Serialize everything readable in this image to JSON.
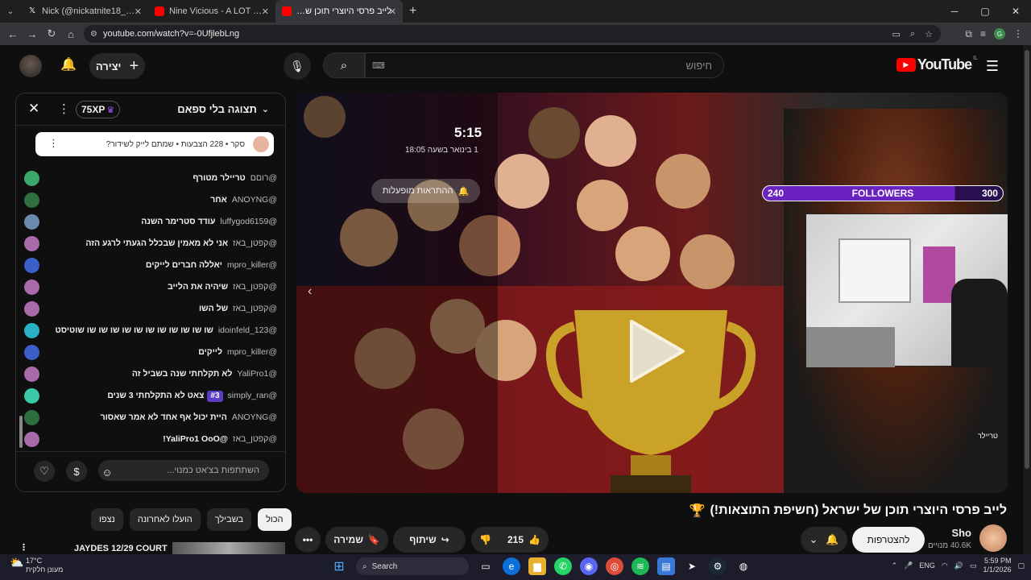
{
  "browser": {
    "tabs": [
      {
        "title": "Nick (@nickatnite18_) / X",
        "active": false
      },
      {
        "title": "Nine Vicious - A LOT (Official M",
        "active": false
      },
      {
        "title": "לייב פרסי היוצרי תוכן של ישראל",
        "active": true
      }
    ],
    "url": "youtube.com/watch?v=-0UfjlebLng",
    "profile_initial": "G"
  },
  "header": {
    "logo_text": "YouTube",
    "logo_region": "IL",
    "search_placeholder": "חיפוש",
    "create_label": "יצירה"
  },
  "chat": {
    "title": "תצוגה בלי ספאם",
    "xp": "75XP",
    "pinned": "סקר • 228 הצבעות • שמתם לייק לשידור?",
    "messages": [
      {
        "author": "@רוםם",
        "text": "טריילר מטורף",
        "color": "#3aa86a"
      },
      {
        "author": "@ANOYNG",
        "text": "אחר",
        "color": "#2f6f3f"
      },
      {
        "author": "@luffygod6159",
        "text": "עודד סטרימר השנה",
        "color": "#6a8ab0"
      },
      {
        "author": "@קפטן_באז",
        "text": "אני לא מאמין שבכלל הגעתי לרגע הזה",
        "color": "#a86aa8"
      },
      {
        "author": "@mpro_killer",
        "text": "יאללה חברים לייקים",
        "color": "#3a5fc8"
      },
      {
        "author": "@קפטן_באז",
        "text": "שיהיה את הלייב",
        "color": "#a86aa8"
      },
      {
        "author": "@קפטן_באז",
        "text": "של השו",
        "color": "#a86aa8"
      },
      {
        "author": "@idoinfeld_123",
        "text": "שו שו שו שו שו שו שו שו שו שו שו שוטיסט",
        "color": "#2ab0c8"
      },
      {
        "author": "@mpro_killer",
        "text": "לייקים",
        "color": "#3a5fc8"
      },
      {
        "author": "@YaliPro1",
        "text": "לא תקלחתי שנה בשביל זה",
        "color": "#a86aa8"
      },
      {
        "author": "@simply_ran",
        "text": "צאט לא התקלחתי 3 שנים",
        "color": "#3ac8a8",
        "badge": "#3"
      },
      {
        "author": "@ANOYNG",
        "text": "היית יכול אף אחד לא אמר שאסור",
        "color": "#2f6f3f"
      },
      {
        "author": "@קפטן_באז",
        "text": "@YaliPro1 OoO!",
        "color": "#a86aa8"
      }
    ],
    "input_placeholder": "השתתפות בצ'אט כמנוי..."
  },
  "video": {
    "countdown": "5:15",
    "start_date": "1 בינואר בשעה 18:05",
    "notif_label": "ההתראות מופעלות",
    "followers_label": "FOLLOWERS",
    "followers_current": "240",
    "followers_goal": "300",
    "followers_progress": 0.8,
    "cam_tag": "טריילר"
  },
  "meta": {
    "title": "לייב פרסי היוצרי תוכן של ישראל (חשיפת התוצאות!)",
    "title_emoji": "🏆",
    "channel": "Sho",
    "subscribers": "40.6K מנויים",
    "join_label": "להצטרפות",
    "likes": "215",
    "share_label": "שיתוף",
    "save_label": "שמירה"
  },
  "filters": [
    "הכול",
    "בשבילך",
    "הועלו לאחרונה",
    "נצפו"
  ],
  "related": {
    "title": "JAYDES 12/29 COURT"
  },
  "taskbar": {
    "temp": "17°C",
    "weather": "מעונן חלקית",
    "search": "Search",
    "lang": "ENG",
    "time": "5:59 PM",
    "date": "1/1/2026"
  }
}
